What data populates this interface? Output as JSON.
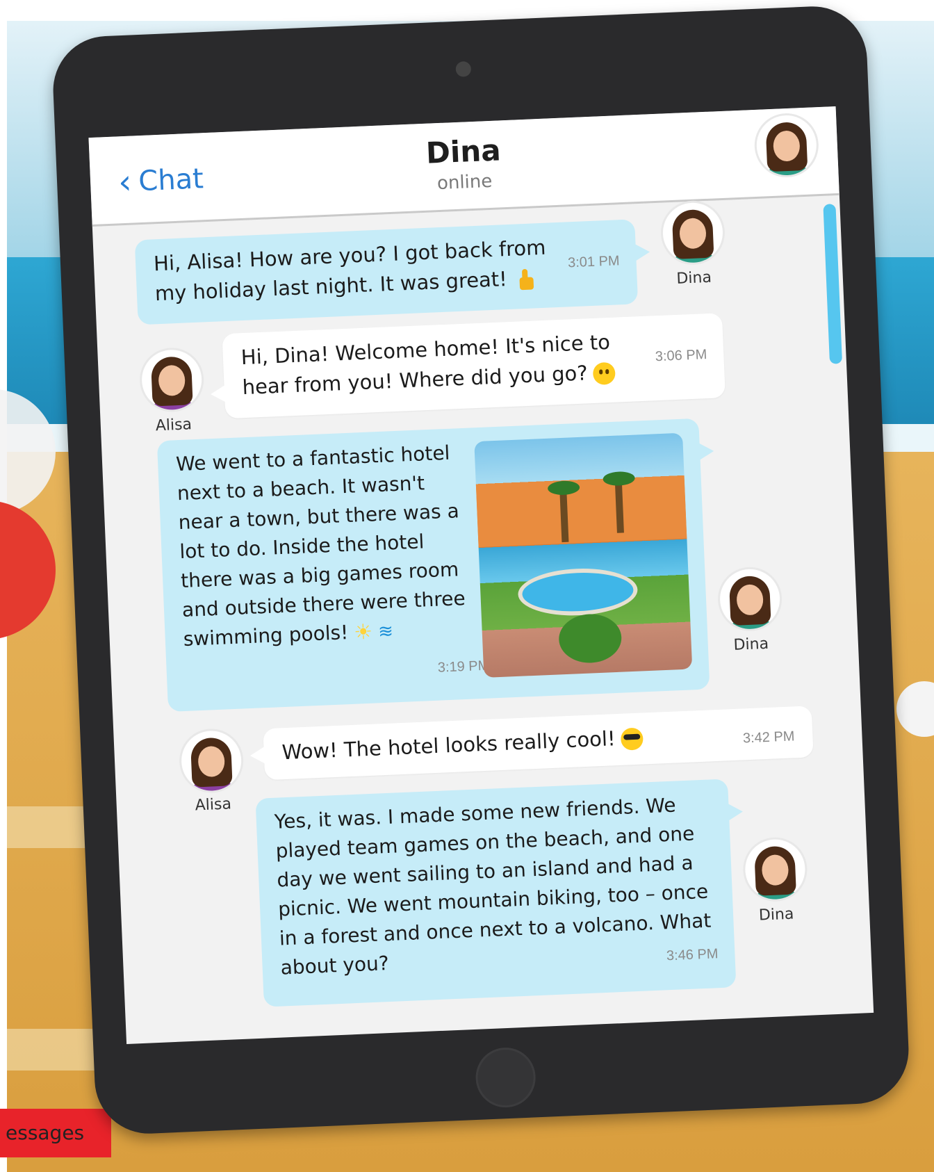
{
  "corner_label": "essages",
  "header": {
    "back_label": "Chat",
    "contact_name": "Dina",
    "status": "online"
  },
  "messages": [
    {
      "sender": "Dina",
      "side": "right",
      "text": "Hi, Alisa! How are you? I got back from my holiday last night. It was great!",
      "emoji": "thumbs-up-icon",
      "time": "3:01 PM"
    },
    {
      "sender": "Alisa",
      "side": "left",
      "text": "Hi, Dina! Welcome home! It's nice to hear from you! Where did you go?",
      "emoji": "smile-icon",
      "time": "3:06 PM"
    },
    {
      "sender": "Dina",
      "side": "right",
      "text": "We went to a fantastic hotel next to a beach. It wasn't near a town, but there was a lot to do. Inside the hotel there was a big games room and outside there were three swimming pools!",
      "emoji": "sun-icon swimmer-icon",
      "time": "3:19 PM",
      "has_photo": true
    },
    {
      "sender": "Alisa",
      "side": "left",
      "text": "Wow! The hotel looks really cool!",
      "emoji": "sunglasses-icon",
      "time": "3:42 PM"
    },
    {
      "sender": "Dina",
      "side": "right",
      "text": "Yes, it was. I made some new friends. We played team games on the beach, and one day we went sailing to an island and had a picnic. We went mountain biking, too – once in a forest and once next to a volcano. What about you?",
      "time": "3:46 PM"
    }
  ],
  "colors": {
    "incoming_bubble": "#c6ecf8",
    "outgoing_bubble": "#ffffff",
    "link_blue": "#2a7dd2",
    "scroll_indicator": "#56c6ef"
  }
}
